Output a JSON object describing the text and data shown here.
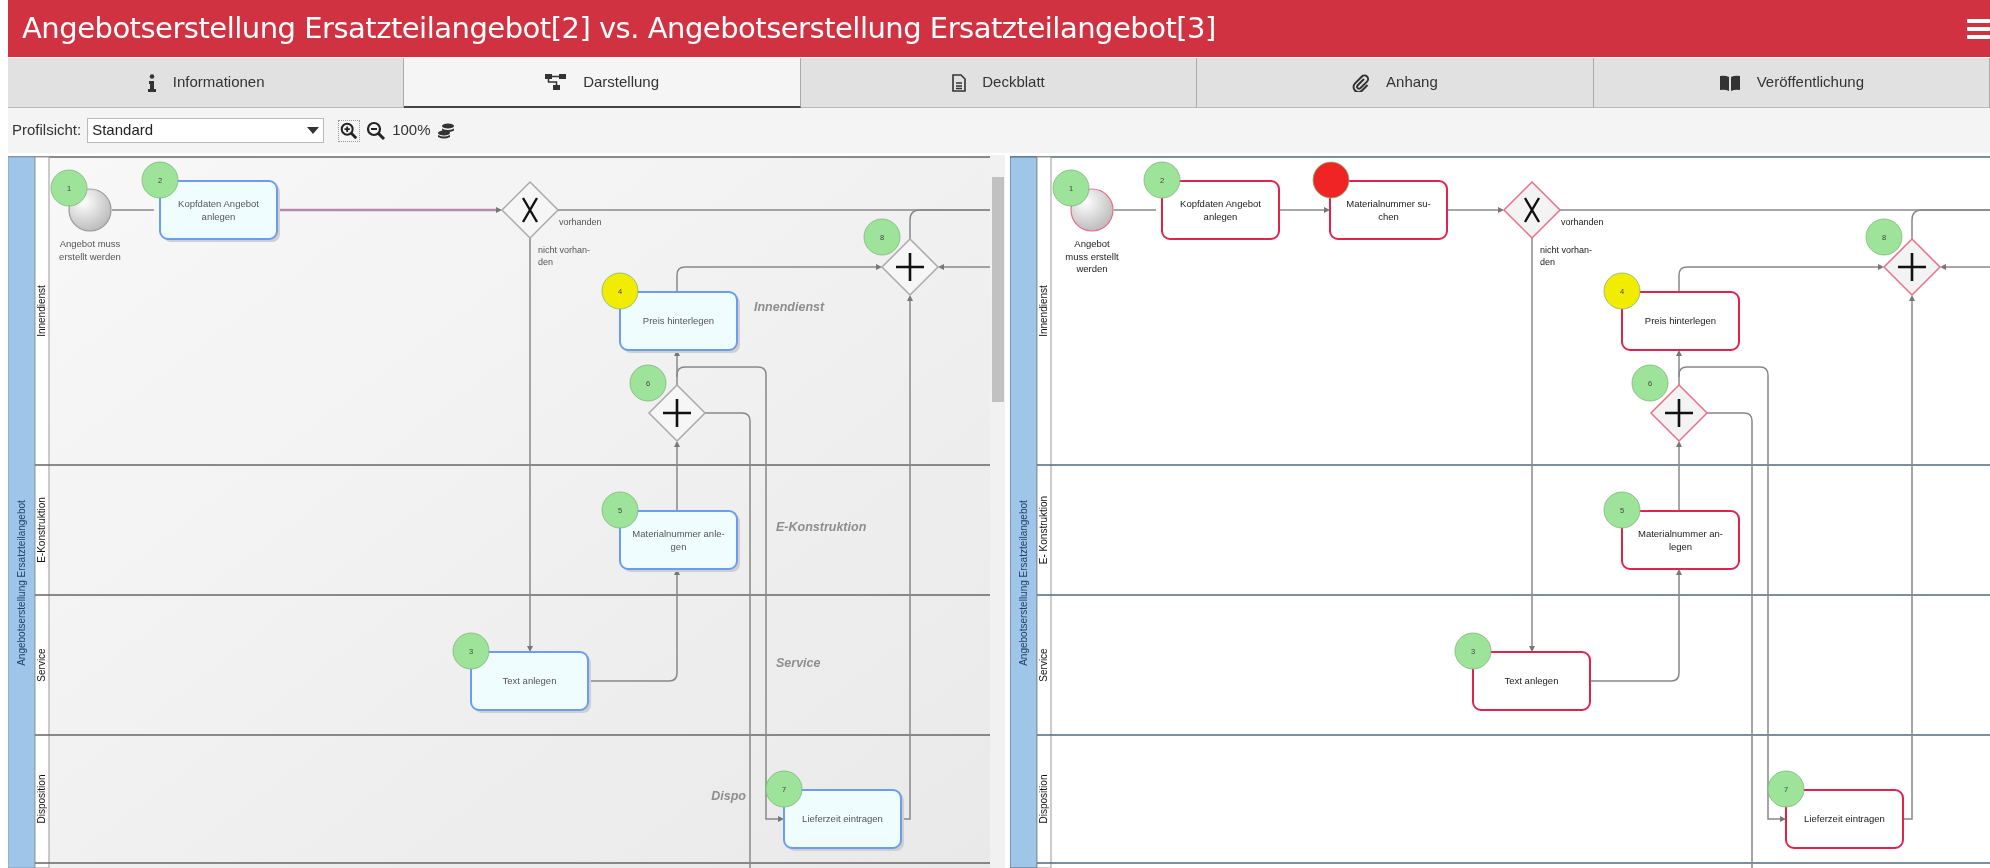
{
  "title": "Angebotserstellung Ersatzteilangebot[2] vs. Angebotserstellung Ersatzteilangebot[3]",
  "tabs": [
    {
      "label": "Informationen",
      "selected": false
    },
    {
      "label": "Darstellung",
      "selected": true
    },
    {
      "label": "Deckblatt",
      "selected": false
    },
    {
      "label": "Anhang",
      "selected": false
    },
    {
      "label": "Veröffentlichung",
      "selected": false
    }
  ],
  "toolbar": {
    "profile_label": "Profilsicht:",
    "profile_value": "Standard",
    "zoom": "100%"
  },
  "diagrams": [
    {
      "highlighted": false,
      "pool": "Angebotserstellung Ersatzteilangebot",
      "lanes": [
        "Innendienst",
        "E-Konstruktion",
        "Service",
        "Disposition"
      ],
      "lane_watermarks": [
        "Innendienst",
        "E-Konstruktion",
        "Service",
        "Dispo"
      ],
      "nodes": [
        {
          "kind": "start",
          "lines": [
            "Angebot muss",
            "erstellt werden"
          ],
          "badge": {
            "text": "1",
            "color": "#9ee39a"
          }
        },
        {
          "kind": "task",
          "lines": [
            "Kopfdaten Angebot",
            "anlegen"
          ],
          "badge": {
            "text": "2",
            "color": "#9ee39a"
          }
        },
        {
          "kind": "exclusive",
          "conditions": [
            [
              "vorhanden"
            ],
            [
              "nicht vorhan-",
              "den"
            ]
          ]
        },
        {
          "kind": "parallel",
          "badge": {
            "text": "8",
            "color": "#9ee39a"
          }
        },
        {
          "kind": "task",
          "lines": [
            "Preis hinterlegen"
          ],
          "badge": {
            "text": "4",
            "color": "#f2ec00"
          }
        },
        {
          "kind": "parallel",
          "badge": {
            "text": "6",
            "color": "#9ee39a"
          }
        },
        {
          "kind": "task",
          "lines": [
            "Materialnummer anle-",
            "gen"
          ],
          "badge": {
            "text": "5",
            "color": "#9ee39a"
          }
        },
        {
          "kind": "task",
          "lines": [
            "Text anlegen"
          ],
          "badge": {
            "text": "3",
            "color": "#9ee39a"
          }
        },
        {
          "kind": "task",
          "lines": [
            "Lieferzeit eintragen"
          ],
          "badge": {
            "text": "7",
            "color": "#9ee39a"
          }
        }
      ]
    },
    {
      "highlighted": true,
      "pool": "Angebotserstellung Ersatzteilangebot",
      "lanes": [
        "Innendienst",
        "E- Konstruktion",
        "Service",
        "Disposition"
      ],
      "nodes": [
        {
          "kind": "start",
          "lines": [
            "Angebot",
            "muss erstellt",
            "werden"
          ],
          "badge": {
            "text": "1",
            "color": "#9ee39a"
          }
        },
        {
          "kind": "task",
          "lines": [
            "Kopfdaten Angebot",
            "anlegen"
          ],
          "badge": {
            "text": "2",
            "color": "#9ee39a"
          }
        },
        {
          "kind": "task",
          "lines": [
            "Materialnummer su-",
            "chen"
          ],
          "badge": {
            "color": "#f02424"
          }
        },
        {
          "kind": "exclusive",
          "conditions": [
            [
              "vorhanden"
            ],
            [
              "nicht vorhan-",
              "den"
            ]
          ]
        },
        {
          "kind": "parallel",
          "badge": {
            "text": "8",
            "color": "#9ee39a"
          }
        },
        {
          "kind": "task",
          "lines": [
            "Preis hinterlegen"
          ],
          "badge": {
            "text": "4",
            "color": "#f2ec00"
          }
        },
        {
          "kind": "parallel",
          "badge": {
            "text": "6",
            "color": "#9ee39a"
          }
        },
        {
          "kind": "task",
          "lines": [
            "Materialnummer an-",
            "legen"
          ],
          "badge": {
            "text": "5",
            "color": "#9ee39a"
          }
        },
        {
          "kind": "task",
          "lines": [
            "Text anlegen"
          ],
          "badge": {
            "text": "3",
            "color": "#9ee39a"
          }
        },
        {
          "kind": "task",
          "lines": [
            "Lieferzeit eintragen"
          ],
          "badge": {
            "text": "7",
            "color": "#9ee39a"
          }
        }
      ]
    }
  ]
}
